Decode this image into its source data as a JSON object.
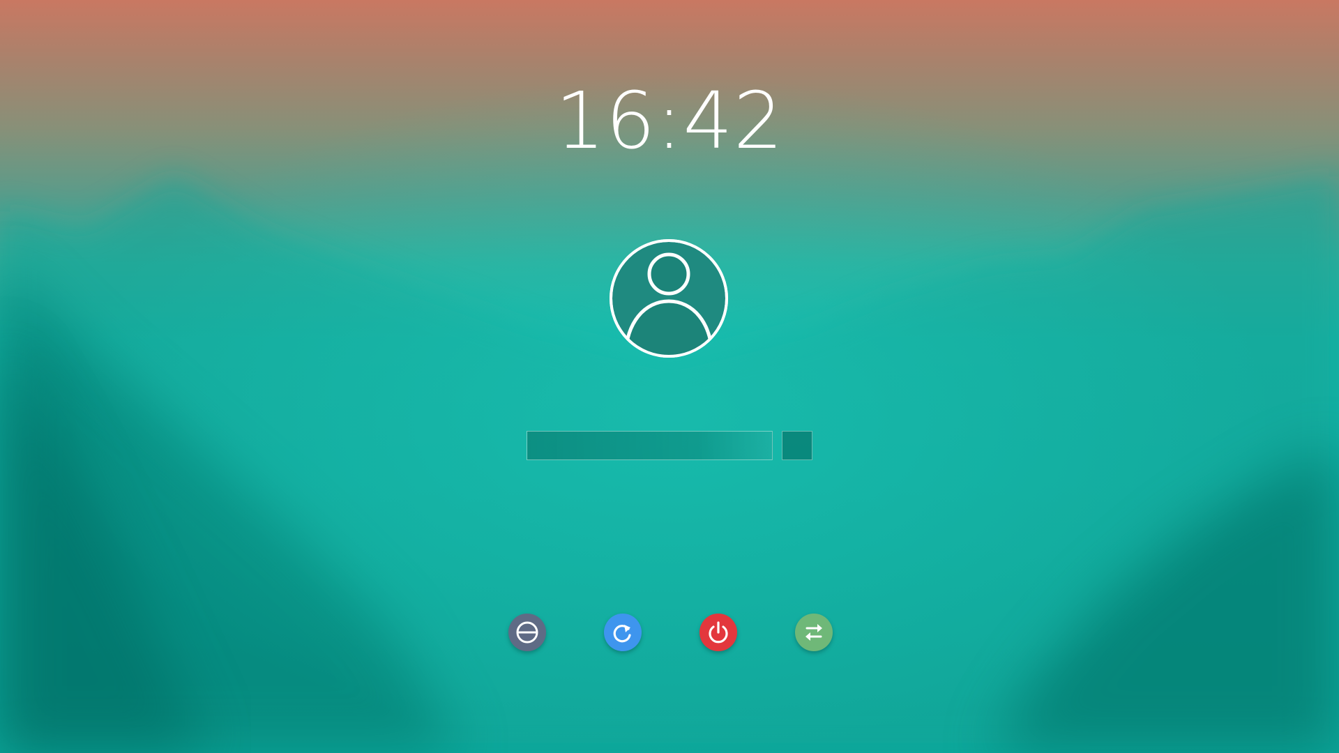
{
  "clock": {
    "time": "16:42"
  },
  "login": {
    "password_value": "",
    "password_placeholder": ""
  },
  "actions": [
    {
      "name": "suspend",
      "icon": "suspend-icon",
      "color": "#5f6b85"
    },
    {
      "name": "restart",
      "icon": "restart-icon",
      "color": "#3e95ee"
    },
    {
      "name": "shutdown",
      "icon": "power-icon",
      "color": "#e3373d"
    },
    {
      "name": "switch-user",
      "icon": "switch-user-icon",
      "color": "#6fb878"
    }
  ],
  "colors": {
    "background_top": "#c97862",
    "background_mid": "#15b3a5",
    "background_bottom": "#0aa89c"
  }
}
